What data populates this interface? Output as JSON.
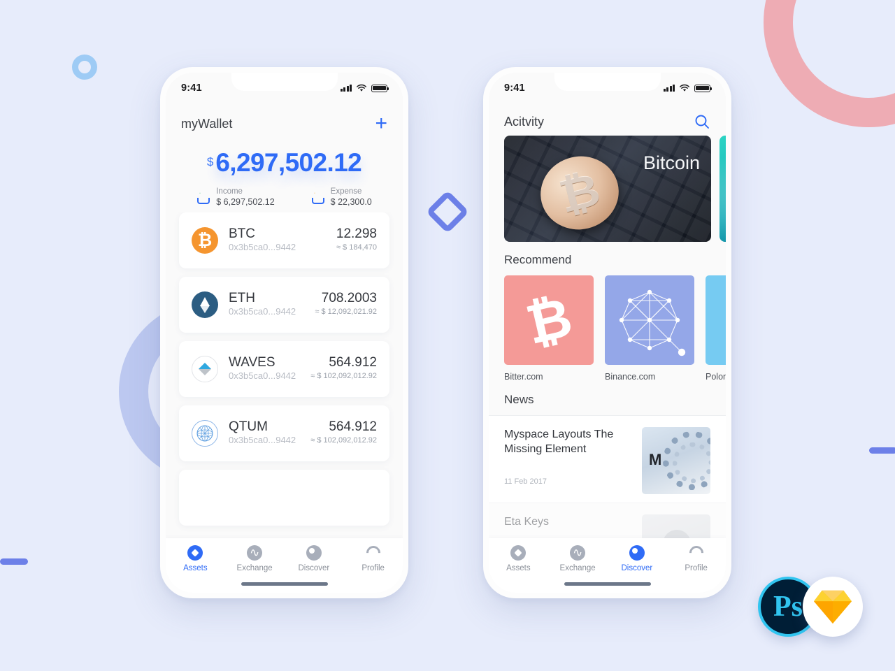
{
  "background": {
    "color": "#e7ecfb",
    "accent_blue": "#2f6bf6"
  },
  "decorations": [
    {
      "name": "ring-pink",
      "color": "#eeacb4"
    },
    {
      "name": "ring-blue",
      "color": "#bcc8f0"
    },
    {
      "name": "ring-small",
      "color": "#9ecbf5"
    },
    {
      "name": "diamond-outline",
      "color": "#6d80e8"
    },
    {
      "name": "pill-left",
      "color": "#6d80e8"
    },
    {
      "name": "pill-right",
      "color": "#6d80e8"
    }
  ],
  "badges": {
    "photoshop": {
      "label": "Ps",
      "ring_color": "#31c5f0",
      "bg_color": "#001e36"
    },
    "sketch": {
      "label": "sketch-diamond",
      "color": "#f7a823"
    }
  },
  "phone_assets": {
    "status_bar": {
      "time": "9:41",
      "signal": "signal-icon",
      "wifi": "wifi-icon",
      "battery": "battery-icon"
    },
    "header": {
      "title": "myWallet",
      "action_icon": "plus-icon",
      "action_label": "+"
    },
    "balance": {
      "currency_symbol": "$",
      "amount": "6,297,502.12",
      "income": {
        "label": "Income",
        "value": "$ 6,297,502.12",
        "icon": "income-tray-down-icon"
      },
      "expense": {
        "label": "Expense",
        "value": "$ 22,300.0",
        "icon": "expense-tray-up-icon"
      }
    },
    "coins": [
      {
        "symbol": "BTC",
        "address": "0x3b5ca0...9442",
        "amount": "12.298",
        "fiat": "≈ $ 184,470",
        "logo": "btc-logo-icon"
      },
      {
        "symbol": "ETH",
        "address": "0x3b5ca0...9442",
        "amount": "708.2003",
        "fiat": "≈ $ 12,092,021.92",
        "logo": "eth-logo-icon"
      },
      {
        "symbol": "WAVES",
        "address": "0x3b5ca0...9442",
        "amount": "564.912",
        "fiat": "≈ $ 102,092,012.92",
        "logo": "waves-logo-icon"
      },
      {
        "symbol": "QTUM",
        "address": "0x3b5ca0...9442",
        "amount": "564.912",
        "fiat": "≈ $ 102,092,012.92",
        "logo": "qtum-logo-icon"
      }
    ],
    "tabs": [
      {
        "label": "Assets",
        "icon": "assets-icon",
        "active": true
      },
      {
        "label": "Exchange",
        "icon": "exchange-icon",
        "active": false
      },
      {
        "label": "Discover",
        "icon": "discover-icon",
        "active": false
      },
      {
        "label": "Profile",
        "icon": "profile-icon",
        "active": false
      }
    ]
  },
  "phone_discover": {
    "status_bar": {
      "time": "9:41",
      "signal": "signal-icon",
      "wifi": "wifi-icon",
      "battery": "battery-icon"
    },
    "header": {
      "title": "Acitvity",
      "action_icon": "search-icon"
    },
    "banners": [
      {
        "caption": "Bitcoin",
        "image": "bitcoin-coin-on-keyboard-photo"
      },
      {
        "caption": "",
        "image": "teal-abstract-photo"
      }
    ],
    "recommend": {
      "section_title": "Recommend",
      "items": [
        {
          "label": "Bitter.com",
          "icon": "bitcoin-symbol-icon",
          "color": "#f49a97"
        },
        {
          "label": "Binance.com",
          "icon": "binance-network-icon",
          "color": "#94a7e8"
        },
        {
          "label": "Polonie",
          "icon": "poloniex-icon",
          "color": "#76cbf2"
        }
      ]
    },
    "news": {
      "section_title": "News",
      "items": [
        {
          "title": "Myspace Layouts The Missing Element",
          "date": "11 Feb 2017",
          "thumb": "ibm-server-photo"
        },
        {
          "title": "Eta Keys",
          "date": "",
          "thumb": "person-avatar-photo"
        }
      ]
    },
    "tabs": [
      {
        "label": "Assets",
        "icon": "assets-icon",
        "active": false
      },
      {
        "label": "Exchange",
        "icon": "exchange-icon",
        "active": false
      },
      {
        "label": "Discover",
        "icon": "discover-icon",
        "active": true
      },
      {
        "label": "Profile",
        "icon": "profile-icon",
        "active": false
      }
    ]
  }
}
